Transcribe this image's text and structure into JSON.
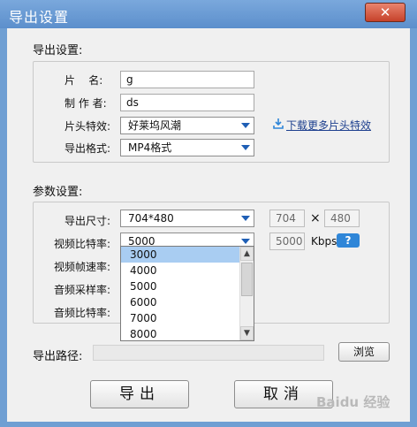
{
  "window": {
    "title": "导出设置",
    "close_label": "✕"
  },
  "export_settings": {
    "section_title": "导出设置:",
    "clip_name": {
      "label": "片    名:",
      "value": "g"
    },
    "author": {
      "label": "制 作 者:",
      "value": "ds"
    },
    "intro_effect": {
      "label": "片头特效:",
      "value": "好莱坞风潮"
    },
    "download_link": "下载更多片头特效",
    "format": {
      "label": "导出格式:",
      "value": "MP4格式"
    }
  },
  "params": {
    "section_title": "参数设置:",
    "size": {
      "label": "导出尺寸:",
      "value": "704*480",
      "width": "704",
      "times": "×",
      "height": "480"
    },
    "video_bitrate": {
      "label": "视频比特率:",
      "value": "5000",
      "custom_value": "5000",
      "unit": "Kbps",
      "help": "?"
    },
    "frame_rate": {
      "label": "视频帧速率:"
    },
    "sample_rate": {
      "label": "音频采样率:"
    },
    "audio_bitrate": {
      "label": "音频比特率:"
    },
    "dropdown_options": [
      "3000",
      "4000",
      "5000",
      "6000",
      "7000",
      "8000"
    ],
    "dropdown_selected": "3000"
  },
  "output": {
    "path_label": "导出路径:",
    "path_value": "",
    "browse_label": "浏览"
  },
  "actions": {
    "export_label": "导出",
    "cancel_label": "取消"
  },
  "watermark": "Baidu 经验",
  "colors": {
    "title_bar": "#5c8fcc",
    "close_button": "#c6422a",
    "selection": "#a9cdf2",
    "link": "#1d3f8e",
    "help_button": "#2f86d8"
  }
}
